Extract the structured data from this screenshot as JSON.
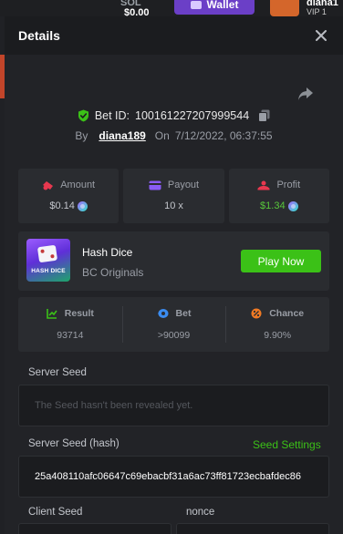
{
  "background": {
    "currency": "SOL",
    "balance": "$0.00",
    "wallet_label": "Wallet",
    "username": "diana1",
    "vip": "VIP 1"
  },
  "dialog": {
    "title": "Details",
    "close_icon": "close-icon",
    "share_icon": "share-icon"
  },
  "bet": {
    "id_label": "Bet ID:",
    "id": "100161227207999544",
    "by_label": "By",
    "user": "diana189",
    "on_label": "On",
    "datetime": "7/12/2022, 06:37:55"
  },
  "stats": [
    {
      "label": "Amount",
      "value": "$0.14",
      "icon": "amount-icon",
      "color": "#e8384f",
      "coin": true,
      "positive": false
    },
    {
      "label": "Payout",
      "value": "10 x",
      "icon": "payout-icon",
      "color": "#8a5cf6",
      "coin": false,
      "positive": false
    },
    {
      "label": "Profit",
      "value": "$1.34",
      "icon": "profit-icon",
      "color": "#e8384f",
      "coin": true,
      "positive": true
    }
  ],
  "game": {
    "name": "Hash Dice",
    "provider": "BC Originals",
    "thumb_label": "HASH DICE",
    "play_label": "Play Now"
  },
  "results": [
    {
      "label": "Result",
      "value": "93714",
      "icon": "result-icon",
      "color": "#3bc117"
    },
    {
      "label": "Bet",
      "value": ">90099",
      "icon": "bet-icon",
      "color": "#3b8cf0"
    },
    {
      "label": "Chance",
      "value": "9.90%",
      "icon": "chance-icon",
      "color": "#f07a24"
    }
  ],
  "seeds": {
    "server_seed_label": "Server Seed",
    "server_seed_placeholder": "The Seed hasn't been revealed yet.",
    "server_hash_label": "Server Seed (hash)",
    "seed_settings_label": "Seed Settings",
    "server_hash_value": "25a408110afc06647c69ebacbf31a6ac73ff81723ecbafdec86",
    "client_seed_label": "Client Seed",
    "nonce_label": "nonce"
  },
  "colors": {
    "accent_green": "#3bc117",
    "dialog_bg": "#222327",
    "card_bg": "#2a2c30"
  }
}
